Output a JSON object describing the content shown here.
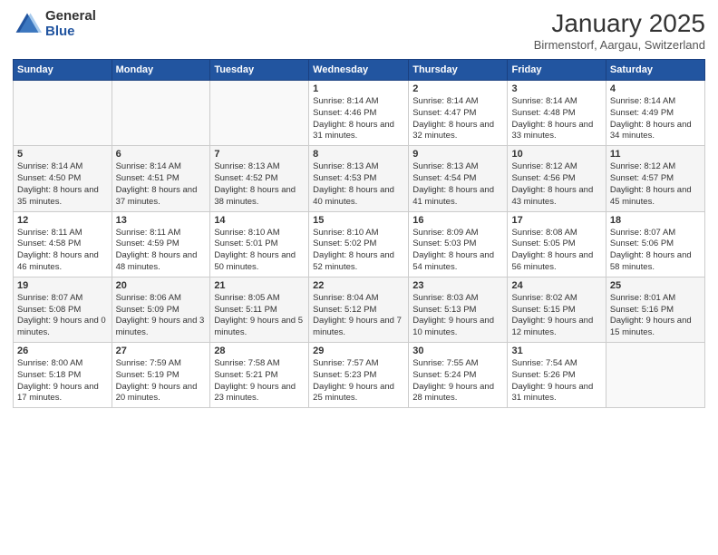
{
  "header": {
    "logo_general": "General",
    "logo_blue": "Blue",
    "month_title": "January 2025",
    "location": "Birmenstorf, Aargau, Switzerland"
  },
  "days_of_week": [
    "Sunday",
    "Monday",
    "Tuesday",
    "Wednesday",
    "Thursday",
    "Friday",
    "Saturday"
  ],
  "weeks": [
    [
      {
        "day": "",
        "info": ""
      },
      {
        "day": "",
        "info": ""
      },
      {
        "day": "",
        "info": ""
      },
      {
        "day": "1",
        "info": "Sunrise: 8:14 AM\nSunset: 4:46 PM\nDaylight: 8 hours\nand 31 minutes."
      },
      {
        "day": "2",
        "info": "Sunrise: 8:14 AM\nSunset: 4:47 PM\nDaylight: 8 hours\nand 32 minutes."
      },
      {
        "day": "3",
        "info": "Sunrise: 8:14 AM\nSunset: 4:48 PM\nDaylight: 8 hours\nand 33 minutes."
      },
      {
        "day": "4",
        "info": "Sunrise: 8:14 AM\nSunset: 4:49 PM\nDaylight: 8 hours\nand 34 minutes."
      }
    ],
    [
      {
        "day": "5",
        "info": "Sunrise: 8:14 AM\nSunset: 4:50 PM\nDaylight: 8 hours\nand 35 minutes."
      },
      {
        "day": "6",
        "info": "Sunrise: 8:14 AM\nSunset: 4:51 PM\nDaylight: 8 hours\nand 37 minutes."
      },
      {
        "day": "7",
        "info": "Sunrise: 8:13 AM\nSunset: 4:52 PM\nDaylight: 8 hours\nand 38 minutes."
      },
      {
        "day": "8",
        "info": "Sunrise: 8:13 AM\nSunset: 4:53 PM\nDaylight: 8 hours\nand 40 minutes."
      },
      {
        "day": "9",
        "info": "Sunrise: 8:13 AM\nSunset: 4:54 PM\nDaylight: 8 hours\nand 41 minutes."
      },
      {
        "day": "10",
        "info": "Sunrise: 8:12 AM\nSunset: 4:56 PM\nDaylight: 8 hours\nand 43 minutes."
      },
      {
        "day": "11",
        "info": "Sunrise: 8:12 AM\nSunset: 4:57 PM\nDaylight: 8 hours\nand 45 minutes."
      }
    ],
    [
      {
        "day": "12",
        "info": "Sunrise: 8:11 AM\nSunset: 4:58 PM\nDaylight: 8 hours\nand 46 minutes."
      },
      {
        "day": "13",
        "info": "Sunrise: 8:11 AM\nSunset: 4:59 PM\nDaylight: 8 hours\nand 48 minutes."
      },
      {
        "day": "14",
        "info": "Sunrise: 8:10 AM\nSunset: 5:01 PM\nDaylight: 8 hours\nand 50 minutes."
      },
      {
        "day": "15",
        "info": "Sunrise: 8:10 AM\nSunset: 5:02 PM\nDaylight: 8 hours\nand 52 minutes."
      },
      {
        "day": "16",
        "info": "Sunrise: 8:09 AM\nSunset: 5:03 PM\nDaylight: 8 hours\nand 54 minutes."
      },
      {
        "day": "17",
        "info": "Sunrise: 8:08 AM\nSunset: 5:05 PM\nDaylight: 8 hours\nand 56 minutes."
      },
      {
        "day": "18",
        "info": "Sunrise: 8:07 AM\nSunset: 5:06 PM\nDaylight: 8 hours\nand 58 minutes."
      }
    ],
    [
      {
        "day": "19",
        "info": "Sunrise: 8:07 AM\nSunset: 5:08 PM\nDaylight: 9 hours\nand 0 minutes."
      },
      {
        "day": "20",
        "info": "Sunrise: 8:06 AM\nSunset: 5:09 PM\nDaylight: 9 hours\nand 3 minutes."
      },
      {
        "day": "21",
        "info": "Sunrise: 8:05 AM\nSunset: 5:11 PM\nDaylight: 9 hours\nand 5 minutes."
      },
      {
        "day": "22",
        "info": "Sunrise: 8:04 AM\nSunset: 5:12 PM\nDaylight: 9 hours\nand 7 minutes."
      },
      {
        "day": "23",
        "info": "Sunrise: 8:03 AM\nSunset: 5:13 PM\nDaylight: 9 hours\nand 10 minutes."
      },
      {
        "day": "24",
        "info": "Sunrise: 8:02 AM\nSunset: 5:15 PM\nDaylight: 9 hours\nand 12 minutes."
      },
      {
        "day": "25",
        "info": "Sunrise: 8:01 AM\nSunset: 5:16 PM\nDaylight: 9 hours\nand 15 minutes."
      }
    ],
    [
      {
        "day": "26",
        "info": "Sunrise: 8:00 AM\nSunset: 5:18 PM\nDaylight: 9 hours\nand 17 minutes."
      },
      {
        "day": "27",
        "info": "Sunrise: 7:59 AM\nSunset: 5:19 PM\nDaylight: 9 hours\nand 20 minutes."
      },
      {
        "day": "28",
        "info": "Sunrise: 7:58 AM\nSunset: 5:21 PM\nDaylight: 9 hours\nand 23 minutes."
      },
      {
        "day": "29",
        "info": "Sunrise: 7:57 AM\nSunset: 5:23 PM\nDaylight: 9 hours\nand 25 minutes."
      },
      {
        "day": "30",
        "info": "Sunrise: 7:55 AM\nSunset: 5:24 PM\nDaylight: 9 hours\nand 28 minutes."
      },
      {
        "day": "31",
        "info": "Sunrise: 7:54 AM\nSunset: 5:26 PM\nDaylight: 9 hours\nand 31 minutes."
      },
      {
        "day": "",
        "info": ""
      }
    ]
  ]
}
